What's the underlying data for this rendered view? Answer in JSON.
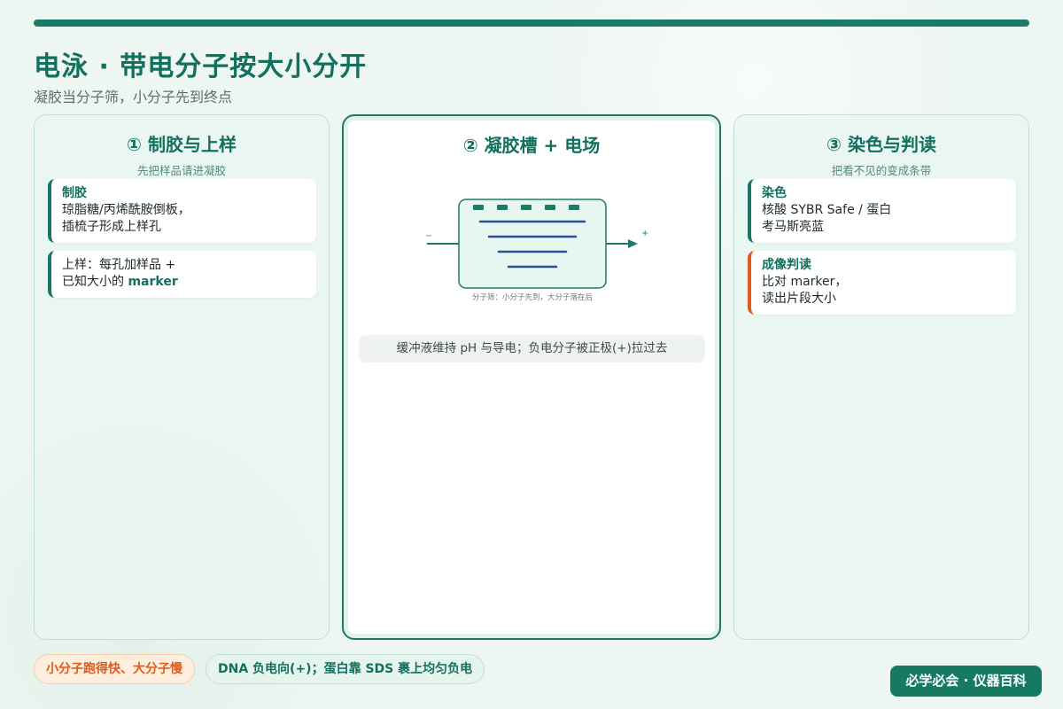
{
  "header": {
    "title": "电泳 · 带电分子按大小分开",
    "subtitle": "凝胶当分子筛，小分子先到终点"
  },
  "panels": [
    {
      "title": "① 制胶与上样",
      "subtitle": "先把样品请进凝胶",
      "cards": [
        {
          "title": "制胶",
          "lines": [
            "琼脂糖/丙烯酰胺倒板，",
            "插梳子形成上样孔"
          ]
        },
        {
          "text_before": "上样：每孔加样品 +",
          "text_mid": "已知大小的 ",
          "highlight": "marker"
        }
      ]
    },
    {
      "title": "② 凝胶槽 + 电场",
      "diagram": {
        "negative_label": "−",
        "positive_label": "+",
        "caption": "分子筛：小分子先到，大分子落在后",
        "wells": 5,
        "bands": 4
      },
      "note": "缓冲液维持 pH 与导电；负电分子被正极(+)拉过去"
    },
    {
      "title": "③ 染色与判读",
      "subtitle": "把看不见的变成条带",
      "cards": [
        {
          "title": "染色",
          "lines": [
            "核酸 SYBR Safe / 蛋白",
            "考马斯亮蓝"
          ]
        },
        {
          "title": "成像判读",
          "lines": [
            "比对 marker，",
            "读出片段大小"
          ]
        }
      ]
    }
  ],
  "footer": {
    "pill_1": "小分子跑得快、大分子慢",
    "pill_2": "DNA 负电向(+)；蛋白靠 SDS 裹上均匀负电",
    "brand": "必学必会 · 仪器百科"
  },
  "colors": {
    "teal": "#13705f",
    "orange": "#e05a1c",
    "band_blue": "#2a4fa0",
    "negative": "#e05a1c"
  }
}
